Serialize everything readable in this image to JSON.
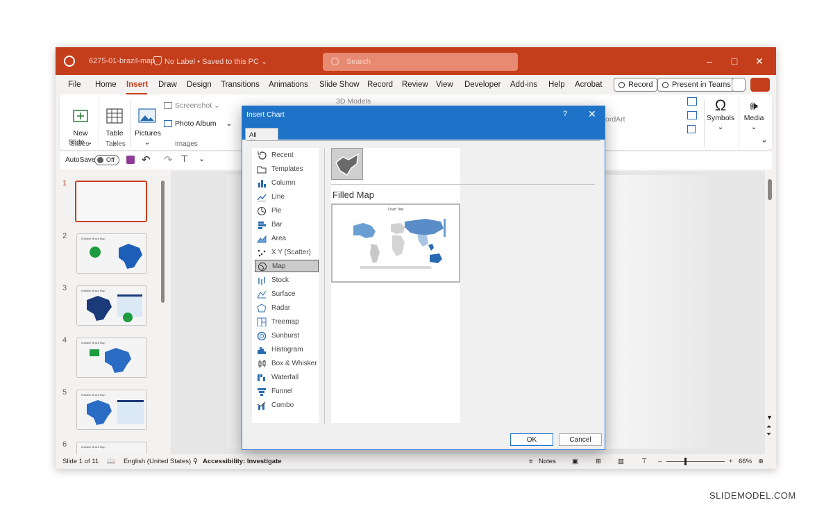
{
  "titlebar": {
    "filename": "6275-01-brazil-map",
    "label_status": "No Label • Saved to this PC ⌄",
    "search_placeholder": "Search"
  },
  "menu": {
    "tabs": [
      "File",
      "Home",
      "Insert",
      "Draw",
      "Design",
      "Transitions",
      "Animations",
      "Slide Show",
      "Record",
      "Review",
      "View",
      "Developer",
      "Add-ins",
      "Help",
      "Acrobat"
    ],
    "active_tab": "Insert",
    "record_button": "Record",
    "teams_button": "Present in Teams"
  },
  "ribbon": {
    "new_slide": "New\nSlide ⌄",
    "table": "Table\n⌄",
    "pictures": "Pictures\n⌄",
    "screenshot": "Screenshot ⌄",
    "photo_album": "Photo Album",
    "models_3d": "3D Models",
    "wordart": "ordArt",
    "symbols": "Symbols",
    "media": "Media",
    "groups": {
      "slides": "Slides",
      "tables": "Tables",
      "images": "Images"
    }
  },
  "qat": {
    "autosave": "AutoSave",
    "toggle_state": "Off"
  },
  "thumbnails": {
    "numbers": [
      "1",
      "2",
      "3",
      "4",
      "5",
      "6"
    ],
    "captions": [
      "",
      "Editable Brazil Map",
      "Editable Brazil Map",
      "Editable Brazil Map",
      "Editable Brazil Map",
      "Editable Brazil Map"
    ]
  },
  "status": {
    "slide_info": "Slide 1 of 11",
    "language": "English (United States)",
    "accessibility": "Accessibility: Investigate",
    "notes": "Notes",
    "zoom": "66%"
  },
  "dialog": {
    "title": "Insert Chart",
    "help": "?",
    "close": "✕",
    "tab": "All Charts",
    "chart_types": [
      "Recent",
      "Templates",
      "Column",
      "Line",
      "Pie",
      "Bar",
      "Area",
      "X Y (Scatter)",
      "Map",
      "Stock",
      "Surface",
      "Radar",
      "Treemap",
      "Sunburst",
      "Histogram",
      "Box & Whisker",
      "Waterfall",
      "Funnel",
      "Combo"
    ],
    "selected_type": "Map",
    "subtype_title": "Filled Map",
    "preview_chart_title": "Chart Title",
    "ok": "OK",
    "cancel": "Cancel"
  },
  "watermark": "SLIDEMODEL.COM"
}
